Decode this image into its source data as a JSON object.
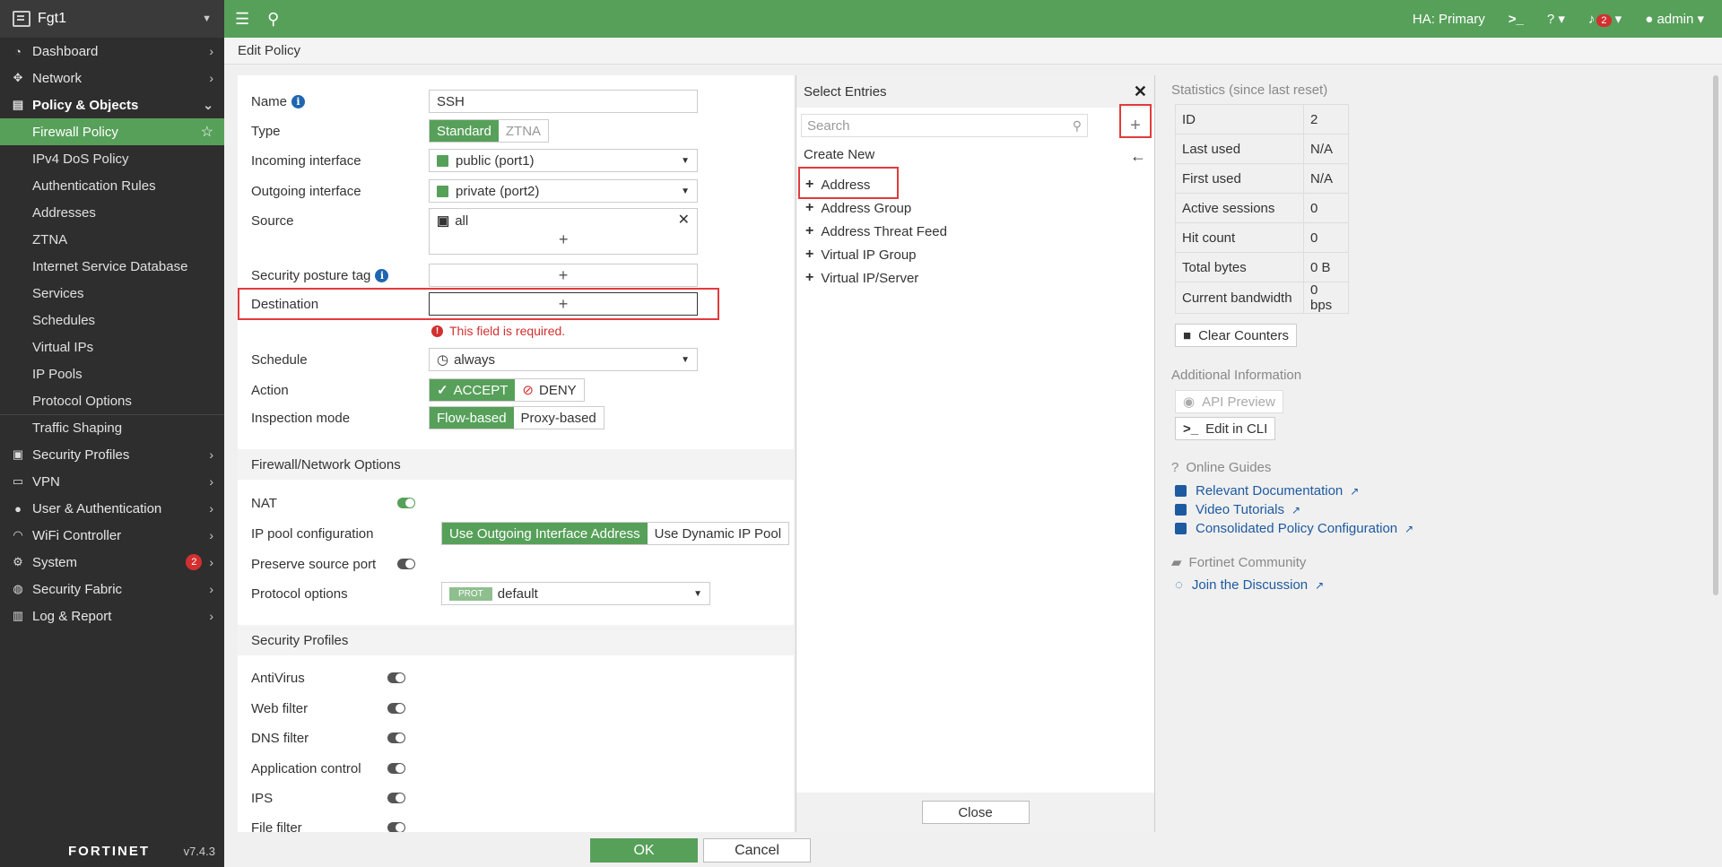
{
  "sidebar": {
    "device_name": "Fgt1",
    "items": [
      {
        "label": "Dashboard",
        "icon": "dashboard-icon"
      },
      {
        "label": "Network",
        "icon": "network-icon"
      },
      {
        "label": "Policy & Objects",
        "icon": "policy-icon"
      },
      {
        "label": "Security Profiles",
        "icon": "lock-icon"
      },
      {
        "label": "VPN",
        "icon": "laptop-icon"
      },
      {
        "label": "User & Authentication",
        "icon": "user-icon"
      },
      {
        "label": "WiFi Controller",
        "icon": "wifi-icon"
      },
      {
        "label": "System",
        "icon": "gear-icon",
        "badge": "2"
      },
      {
        "label": "Security Fabric",
        "icon": "fabric-icon"
      },
      {
        "label": "Log & Report",
        "icon": "chart-icon"
      }
    ],
    "policy_sub": [
      "Firewall Policy",
      "IPv4 DoS Policy",
      "Authentication Rules",
      "Addresses",
      "ZTNA",
      "Internet Service Database",
      "Services",
      "Schedules",
      "Virtual IPs",
      "IP Pools",
      "Protocol Options",
      "Traffic Shaping"
    ],
    "footer_logo": "FORTINET",
    "version": "v7.4.3"
  },
  "topbar": {
    "ha_status": "HA: Primary",
    "notif_count": "2",
    "user": "admin"
  },
  "breadcrumb": "Edit Policy",
  "form": {
    "name_label": "Name",
    "name_value": "SSH",
    "type_label": "Type",
    "type_standard": "Standard",
    "type_ztna": "ZTNA",
    "incoming_label": "Incoming interface",
    "incoming_value": "public (port1)",
    "outgoing_label": "Outgoing interface",
    "outgoing_value": "private (port2)",
    "source_label": "Source",
    "source_value": "all",
    "posture_label": "Security posture tag",
    "destination_label": "Destination",
    "destination_error": "This field is required.",
    "schedule_label": "Schedule",
    "schedule_value": "always",
    "action_label": "Action",
    "action_accept": "ACCEPT",
    "action_deny": "DENY",
    "inspection_label": "Inspection mode",
    "inspection_flow": "Flow-based",
    "inspection_proxy": "Proxy-based",
    "section_fw": "Firewall/Network Options",
    "nat_label": "NAT",
    "ippool_label": "IP pool configuration",
    "ippool_outgoing": "Use Outgoing Interface Address",
    "ippool_dynamic": "Use Dynamic IP Pool",
    "preserve_label": "Preserve source port",
    "protocol_label": "Protocol options",
    "protocol_tag": "PROT",
    "protocol_value": "default",
    "section_sec": "Security Profiles",
    "antivirus": "AntiVirus",
    "webfilter": "Web filter",
    "dnsfilter": "DNS filter",
    "appcontrol": "Application control",
    "ips": "IPS",
    "filefilter": "File filter"
  },
  "select_panel": {
    "title": "Select Entries",
    "search_placeholder": "Search",
    "create_new": "Create New",
    "items": [
      "Address",
      "Address Group",
      "Address Threat Feed",
      "Virtual IP Group",
      "Virtual IP/Server"
    ],
    "close": "Close"
  },
  "right": {
    "stats_title": "Statistics (since last reset)",
    "stats": [
      {
        "k": "ID",
        "v": "2"
      },
      {
        "k": "Last used",
        "v": "N/A"
      },
      {
        "k": "First used",
        "v": "N/A"
      },
      {
        "k": "Active sessions",
        "v": "0"
      },
      {
        "k": "Hit count",
        "v": "0"
      },
      {
        "k": "Total bytes",
        "v": "0 B"
      },
      {
        "k": "Current bandwidth",
        "v": "0 bps"
      }
    ],
    "clear_counters": "Clear Counters",
    "additional_info": "Additional Information",
    "api_preview": "API Preview",
    "edit_cli": "Edit in CLI",
    "online_guides": "Online Guides",
    "relevant_doc": "Relevant Documentation",
    "video_tutorials": "Video Tutorials",
    "consolidated": "Consolidated Policy Configuration",
    "community": "Fortinet Community",
    "join": "Join the Discussion"
  },
  "buttons": {
    "ok": "OK",
    "cancel": "Cancel"
  }
}
